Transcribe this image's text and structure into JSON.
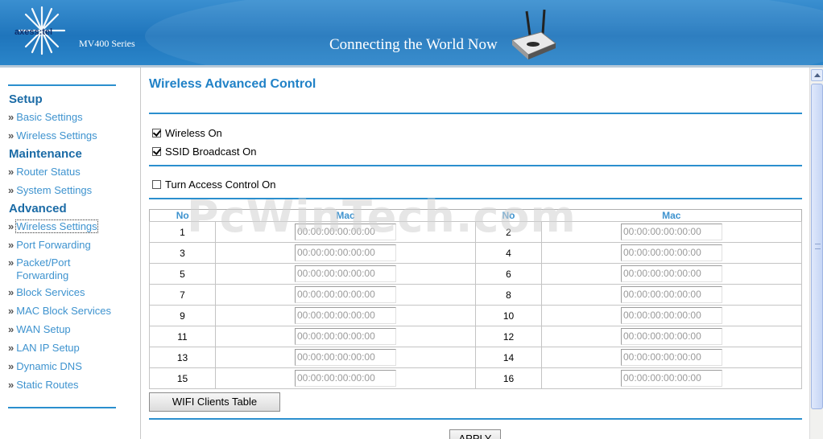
{
  "header": {
    "brand": "axess:tel",
    "series": "MV400 Series",
    "tagline": "Connecting the World Now"
  },
  "sidebar": {
    "sections": [
      {
        "heading": "Setup",
        "items": [
          "Basic Settings",
          "Wireless Settings"
        ]
      },
      {
        "heading": "Maintenance",
        "items": [
          "Router Status",
          "System Settings"
        ]
      },
      {
        "heading": "Advanced",
        "items": [
          "Wireless Settings",
          "Port Forwarding",
          "Packet/Port Forwarding",
          "Block Services",
          "MAC Block Services",
          "WAN Setup",
          "LAN IP Setup",
          "Dynamic DNS",
          "Static Routes"
        ]
      }
    ],
    "selected": "Advanced > Wireless Settings"
  },
  "main": {
    "title": "Wireless Advanced Control",
    "checkboxes": [
      {
        "label": "Wireless On",
        "checked": true
      },
      {
        "label": "SSID Broadcast On",
        "checked": true
      },
      {
        "label": "Turn Access Control On",
        "checked": false
      }
    ],
    "table": {
      "headers": [
        "No",
        "Mac",
        "No",
        "Mac"
      ],
      "rows": [
        {
          "left_no": "1",
          "left_mac": "00:00:00:00:00:00",
          "right_no": "2",
          "right_mac": "00:00:00:00:00:00"
        },
        {
          "left_no": "3",
          "left_mac": "00:00:00:00:00:00",
          "right_no": "4",
          "right_mac": "00:00:00:00:00:00"
        },
        {
          "left_no": "5",
          "left_mac": "00:00:00:00:00:00",
          "right_no": "6",
          "right_mac": "00:00:00:00:00:00"
        },
        {
          "left_no": "7",
          "left_mac": "00:00:00:00:00:00",
          "right_no": "8",
          "right_mac": "00:00:00:00:00:00"
        },
        {
          "left_no": "9",
          "left_mac": "00:00:00:00:00:00",
          "right_no": "10",
          "right_mac": "00:00:00:00:00:00"
        },
        {
          "left_no": "11",
          "left_mac": "00:00:00:00:00:00",
          "right_no": "12",
          "right_mac": "00:00:00:00:00:00"
        },
        {
          "left_no": "13",
          "left_mac": "00:00:00:00:00:00",
          "right_no": "14",
          "right_mac": "00:00:00:00:00:00"
        },
        {
          "left_no": "15",
          "left_mac": "00:00:00:00:00:00",
          "right_no": "16",
          "right_mac": "00:00:00:00:00:00"
        }
      ]
    },
    "wifi_clients_button": "WIFI Clients Table",
    "apply_button": "APPLY"
  },
  "watermark": "PcWinTech.com",
  "colors": {
    "banner": "#1f75bc",
    "accent": "#2b8fce",
    "link": "#3e93cf",
    "heading": "#1b6ba6"
  }
}
